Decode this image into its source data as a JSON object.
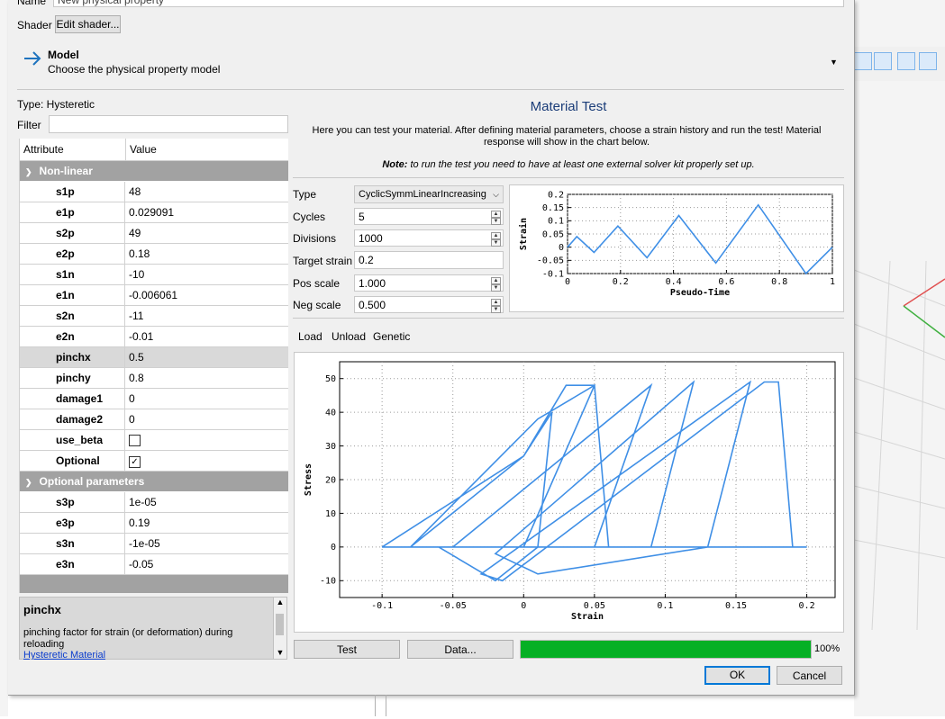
{
  "header": {
    "name_label": "Name",
    "name_value": "New physical property",
    "shader_label": "Shader",
    "edit_shader_label": "Edit shader...",
    "model_title": "Model",
    "model_subtitle": "Choose the physical property model"
  },
  "left": {
    "type_text": "Type:  Hysteretic",
    "filter_label": "Filter",
    "filter_value": "",
    "col_attribute": "Attribute",
    "col_value": "Value",
    "groups": [
      {
        "title": "Non-linear",
        "rows": [
          {
            "name": "s1p",
            "value": "48"
          },
          {
            "name": "e1p",
            "value": "0.029091"
          },
          {
            "name": "s2p",
            "value": "49"
          },
          {
            "name": "e2p",
            "value": "0.18"
          },
          {
            "name": "s1n",
            "value": "-10"
          },
          {
            "name": "e1n",
            "value": "-0.006061"
          },
          {
            "name": "s2n",
            "value": "-11"
          },
          {
            "name": "e2n",
            "value": "-0.01"
          },
          {
            "name": "pinchx",
            "value": "0.5"
          },
          {
            "name": "pinchy",
            "value": "0.8"
          },
          {
            "name": "damage1",
            "value": "0"
          },
          {
            "name": "damage2",
            "value": "0"
          },
          {
            "name": "use_beta",
            "value": "",
            "checkbox": true,
            "checked": false
          },
          {
            "name": "Optional",
            "value": "",
            "checkbox": true,
            "checked": true
          }
        ]
      },
      {
        "title": "Optional parameters",
        "rows": [
          {
            "name": "s3p",
            "value": "1e-05"
          },
          {
            "name": "e3p",
            "value": "0.19"
          },
          {
            "name": "s3n",
            "value": "-1e-05"
          },
          {
            "name": "e3n",
            "value": "-0.05"
          }
        ]
      }
    ],
    "help_title": "pinchx",
    "help_text": "pinching factor for strain (or deformation) during reloading",
    "help_link": "Hysteretic Material"
  },
  "test": {
    "title": "Material Test",
    "intro": "Here you can test your material. After defining material parameters, choose a strain history and run the test! Material response will show in the chart below.",
    "note_label": "Note:",
    "note_text": " to run the test you need to have at least one external solver kit properly set up.",
    "type_label": "Type",
    "type_value": "CyclicSymmLinearIncreasing",
    "cycles_label": "Cycles",
    "cycles_value": "5",
    "divisions_label": "Divisions",
    "divisions_value": "1000",
    "target_label": "Target strain",
    "target_value": "0.2",
    "pos_label": "Pos scale",
    "pos_value": "1.000",
    "neg_label": "Neg scale",
    "neg_value": "0.500",
    "tabs": [
      "Load",
      "Unload",
      "Genetic"
    ],
    "test_button": "Test",
    "data_button": "Data...",
    "progress": 100,
    "progress_text": "100%",
    "ok_button": "OK",
    "cancel_button": "Cancel"
  },
  "chart_data": [
    {
      "type": "line",
      "xlabel": "Pseudo-Time",
      "ylabel": "Strain",
      "xlim": [
        0,
        1
      ],
      "ylim": [
        -0.1,
        0.2
      ],
      "xticks": [
        "0",
        "0.2",
        "0.4",
        "0.6",
        "0.8",
        "1"
      ],
      "yticks": [
        "-0.1",
        "-0.05",
        "0",
        "0.05",
        "0.1",
        "0.15",
        "0.2"
      ],
      "grid": true,
      "color": "#3f8fe6",
      "x": [
        0,
        0.035,
        0.1,
        0.19,
        0.3,
        0.42,
        0.56,
        0.72,
        0.9,
        1.0
      ],
      "y": [
        0,
        0.04,
        -0.02,
        0.08,
        -0.04,
        0.12,
        -0.06,
        0.16,
        -0.1,
        0.0
      ]
    },
    {
      "type": "line",
      "xlabel": "Strain",
      "ylabel": "Stress",
      "xlim": [
        -0.13,
        0.22
      ],
      "ylim": [
        -15,
        55
      ],
      "xticks": [
        "-0.1",
        "-0.05",
        "0",
        "0.05",
        "0.1",
        "0.15",
        "0.2"
      ],
      "yticks": [
        "-10",
        "0",
        "10",
        "20",
        "30",
        "40",
        "50"
      ],
      "grid": true,
      "color": "#3f8fe6",
      "x": [
        -0.1,
        0.2,
        0.19,
        0.18,
        0.17,
        -0.015,
        -0.03,
        0.16,
        0.13,
        0.01,
        -0.02,
        0.12,
        0.09,
        -0.05,
        0.09,
        0.05,
        -0.04,
        0.06,
        0.05,
        0.01,
        -0.08,
        0.0,
        0.03,
        0.05,
        0.0,
        -0.06,
        -0.02,
        0.01,
        0.02,
        0.0,
        -0.1
      ],
      "y": [
        0,
        0,
        0,
        49,
        49,
        -10,
        -8,
        49,
        0,
        -8,
        -2,
        49,
        0,
        0,
        48,
        0,
        0,
        0,
        48,
        38,
        0,
        27,
        48,
        48,
        0,
        0,
        -10,
        0,
        40,
        27,
        0
      ]
    }
  ]
}
